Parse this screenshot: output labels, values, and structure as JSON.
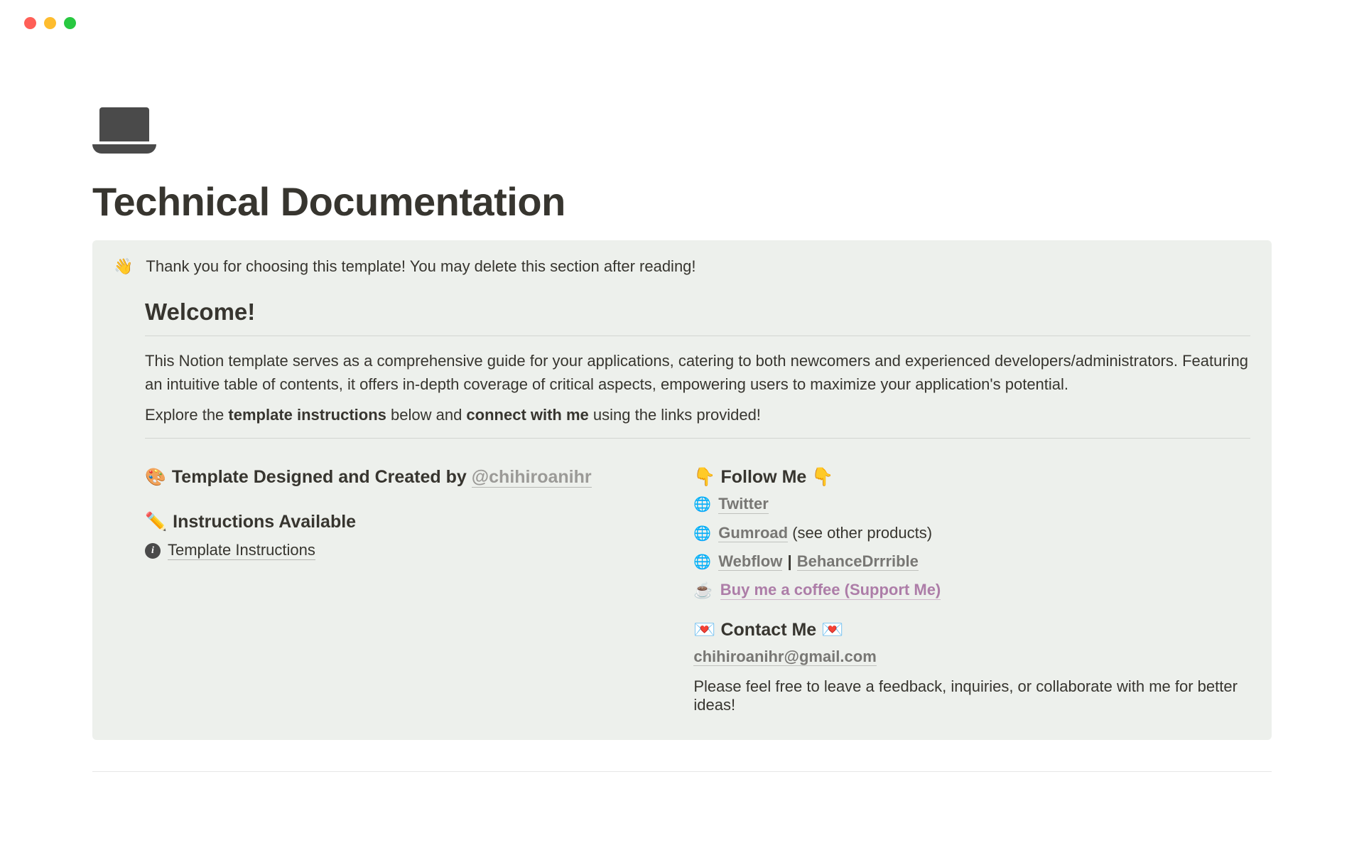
{
  "page": {
    "title": "Technical Documentation"
  },
  "callout": {
    "intro_emoji": "👋",
    "intro_text": "Thank you for choosing this template! You may delete this section after reading!",
    "welcome_heading": "Welcome!",
    "description": "This Notion template serves as a comprehensive guide for your applications, catering to both newcomers and experienced developers/administrators. Featuring an intuitive table of contents, it offers in-depth coverage of critical aspects, empowering users to maximize your application's potential.",
    "explore_prefix": "Explore the ",
    "explore_bold1": "template instructions",
    "explore_mid": " below and ",
    "explore_bold2": "connect with me",
    "explore_suffix": " using the links provided!"
  },
  "left": {
    "designed_emoji": "🎨",
    "designed_text": "Template Designed and Created by ",
    "author_handle": "@chihiroanihr",
    "instructions_emoji": "✏️",
    "instructions_heading": "Instructions Available",
    "instructions_link": "Template Instructions"
  },
  "right": {
    "follow_emoji_left": "👇",
    "follow_text": "Follow Me",
    "follow_emoji_right": "👇",
    "links": {
      "twitter": "Twitter",
      "gumroad": "Gumroad",
      "gumroad_note": " (see other products)",
      "webflow": "Webflow",
      "behance": "Behance",
      "drrrible": "Drrrible",
      "coffee_emoji": "☕",
      "coffee": "Buy me a coffee (Support Me)"
    },
    "contact_emoji_left": "💌",
    "contact_text": "Contact Me",
    "contact_emoji_right": "💌",
    "email": "chihiroanihr@gmail.com",
    "feedback": "Please feel free to leave a feedback, inquiries, or collaborate with me for better ideas!"
  },
  "icons": {
    "globe": "🌐",
    "info": "i"
  }
}
